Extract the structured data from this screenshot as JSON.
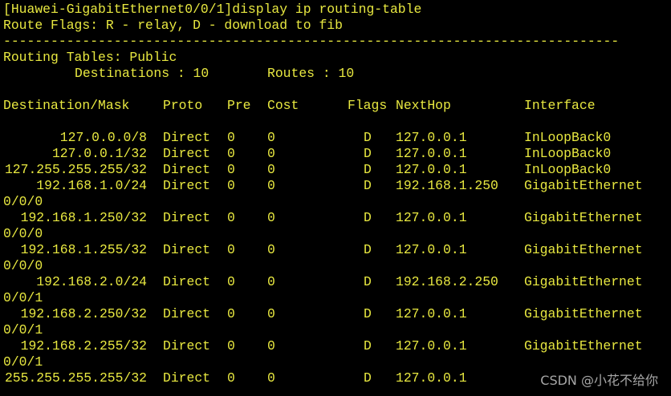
{
  "terminal": {
    "command_line": "[Huawei-GigabitEthernet0/0/1]display ip routing-table",
    "flags_legend": "Route Flags: R - relay, D - download to fib",
    "separator": "------------------------------------------------------------------------------",
    "tables_title": "Routing Tables: Public",
    "destinations_label": "Destinations : 10",
    "routes_label": "Routes : 10",
    "headers": {
      "destination": "Destination/Mask",
      "proto": "Proto",
      "pre": "Pre",
      "cost": "Cost",
      "flags": "Flags",
      "nexthop": "NextHop",
      "interface": "Interface"
    },
    "routes": [
      {
        "dest": "127.0.0.0/8",
        "proto": "Direct",
        "pre": "0",
        "cost": "0",
        "flags": "D",
        "nexthop": "127.0.0.1",
        "iface": "InLoopBack0",
        "iface_cont": ""
      },
      {
        "dest": "127.0.0.1/32",
        "proto": "Direct",
        "pre": "0",
        "cost": "0",
        "flags": "D",
        "nexthop": "127.0.0.1",
        "iface": "InLoopBack0",
        "iface_cont": ""
      },
      {
        "dest": "127.255.255.255/32",
        "proto": "Direct",
        "pre": "0",
        "cost": "0",
        "flags": "D",
        "nexthop": "127.0.0.1",
        "iface": "InLoopBack0",
        "iface_cont": ""
      },
      {
        "dest": "192.168.1.0/24",
        "proto": "Direct",
        "pre": "0",
        "cost": "0",
        "flags": "D",
        "nexthop": "192.168.1.250",
        "iface": "GigabitEthernet",
        "iface_cont": "0/0/0"
      },
      {
        "dest": "192.168.1.250/32",
        "proto": "Direct",
        "pre": "0",
        "cost": "0",
        "flags": "D",
        "nexthop": "127.0.0.1",
        "iface": "GigabitEthernet",
        "iface_cont": "0/0/0"
      },
      {
        "dest": "192.168.1.255/32",
        "proto": "Direct",
        "pre": "0",
        "cost": "0",
        "flags": "D",
        "nexthop": "127.0.0.1",
        "iface": "GigabitEthernet",
        "iface_cont": "0/0/0"
      },
      {
        "dest": "192.168.2.0/24",
        "proto": "Direct",
        "pre": "0",
        "cost": "0",
        "flags": "D",
        "nexthop": "192.168.2.250",
        "iface": "GigabitEthernet",
        "iface_cont": "0/0/1"
      },
      {
        "dest": "192.168.2.250/32",
        "proto": "Direct",
        "pre": "0",
        "cost": "0",
        "flags": "D",
        "nexthop": "127.0.0.1",
        "iface": "GigabitEthernet",
        "iface_cont": "0/0/1"
      },
      {
        "dest": "192.168.2.255/32",
        "proto": "Direct",
        "pre": "0",
        "cost": "0",
        "flags": "D",
        "nexthop": "127.0.0.1",
        "iface": "GigabitEthernet",
        "iface_cont": "0/0/1"
      },
      {
        "dest": "255.255.255.255/32",
        "proto": "Direct",
        "pre": "0",
        "cost": "0",
        "flags": "D",
        "nexthop": "127.0.0.1",
        "iface": "",
        "iface_cont": ""
      }
    ],
    "text_color": "#e8e840",
    "background_color": "#000000"
  },
  "watermark": "CSDN @小花不给你"
}
